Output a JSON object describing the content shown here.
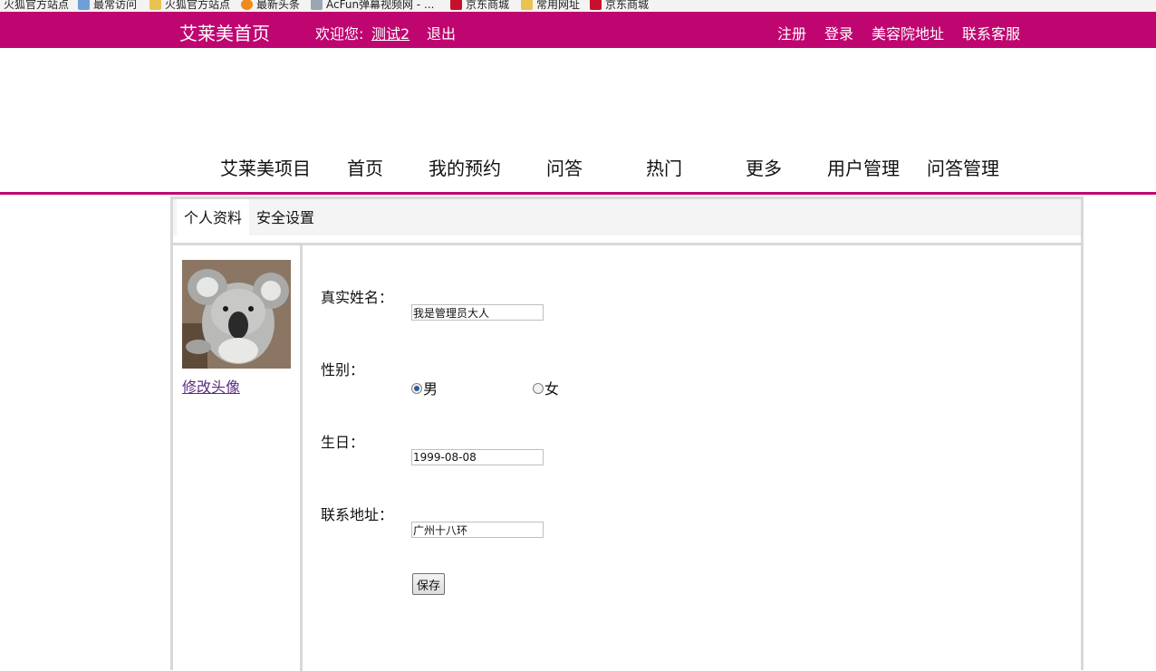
{
  "bookmarks": [
    {
      "label": "火狐官方站点",
      "icon": "folder-icon"
    },
    {
      "label": "最常访问",
      "icon": "star-folder-icon"
    },
    {
      "label": "火狐官方站点",
      "icon": "folder-icon"
    },
    {
      "label": "最新头条",
      "icon": "fire-icon"
    },
    {
      "label": "AcFun弹幕视频网 - ...",
      "icon": "acfun-icon"
    },
    {
      "label": "京东商城",
      "icon": "jd-icon"
    },
    {
      "label": "常用网址",
      "icon": "folder-icon"
    },
    {
      "label": "京东商城",
      "icon": "jd-icon"
    }
  ],
  "topbar": {
    "brand": "艾莱美首页",
    "welcome": "欢迎您:",
    "username": "测试2",
    "logout": "退出",
    "links": [
      "注册",
      "登录",
      "美容院地址",
      "联系客服"
    ],
    "bg_color": "#bf0670"
  },
  "nav": {
    "items": [
      "艾莱美项目",
      "首页",
      "我的预约",
      "问答",
      "热门",
      "更多",
      "用户管理",
      "问答管理"
    ]
  },
  "tabs": [
    "个人资料",
    "安全设置"
  ],
  "sidebar": {
    "avatar_alt": "koala-avatar",
    "change_avatar": "修改头像"
  },
  "form": {
    "name_label": "真实姓名：",
    "name_value": "我是管理员大人",
    "gender_label": "性别：",
    "gender_male": "男",
    "gender_female": "女",
    "gender_selected": "男",
    "birthday_label": "生日：",
    "birthday_value": "1999-08-08",
    "address_label": "联系地址：",
    "address_value": "广州十八环",
    "save_label": "保存"
  }
}
